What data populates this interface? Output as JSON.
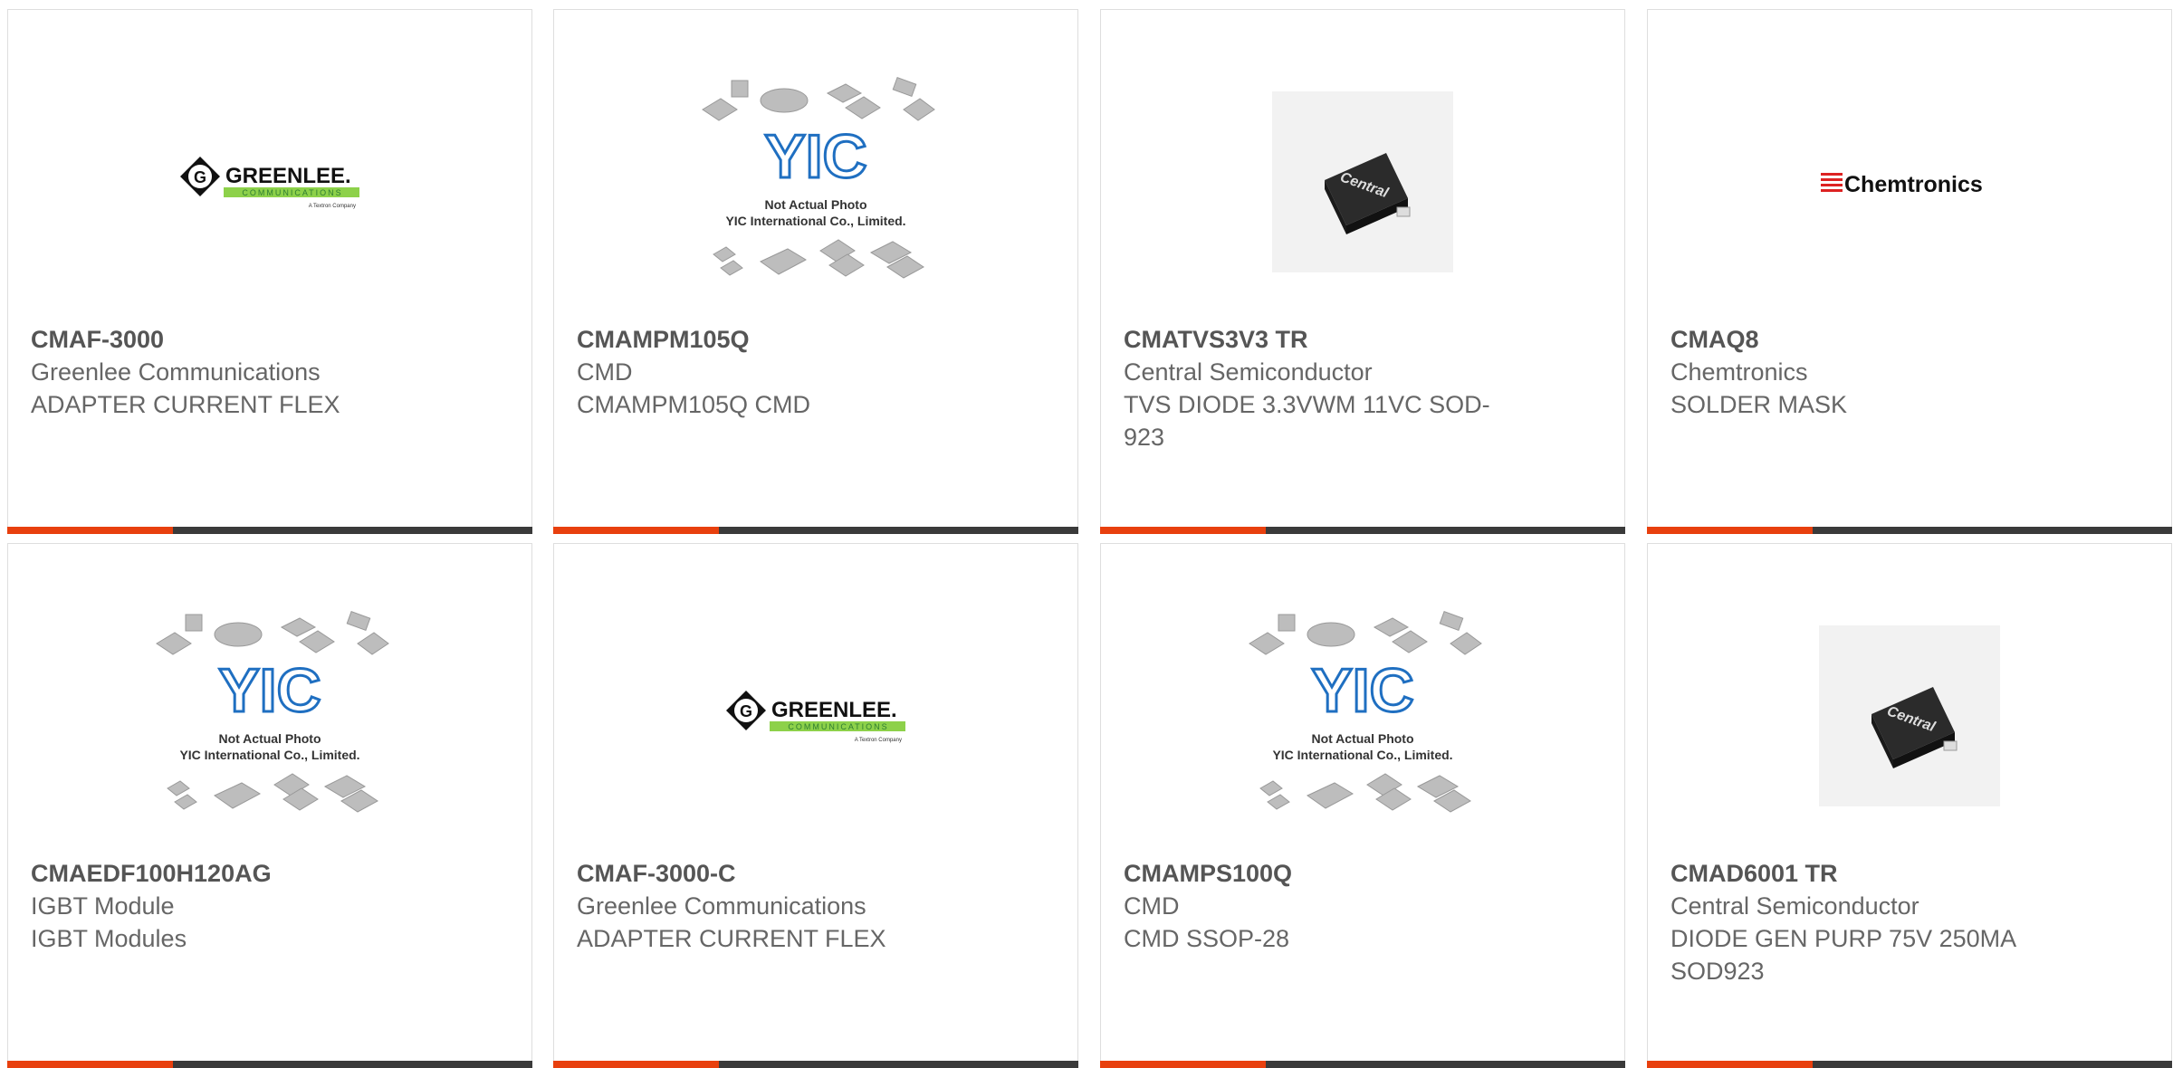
{
  "theme": {
    "accent": "#e8400e",
    "bar_dark": "#3a3a3a"
  },
  "products": [
    {
      "part": "CMAF-3000",
      "manufacturer": "Greenlee Communications",
      "description": "ADAPTER CURRENT FLEX",
      "image": "greenlee-logo",
      "logo": {
        "brand": "GREENLEE.",
        "sub": "COMMUNICATIONS",
        "tag": "A Textron Company"
      }
    },
    {
      "part": "CMAMPM105Q",
      "manufacturer": "CMD",
      "description": "CMAMPM105Q CMD",
      "image": "yic-placeholder",
      "placeholder": {
        "brand": "YIC",
        "line1": "Not Actual Photo",
        "line2": "YIC International Co., Limited."
      }
    },
    {
      "part": "CMATVS3V3 TR",
      "manufacturer": "Central Semiconductor",
      "description": "TVS DIODE 3.3VWM 11VC SOD-923",
      "image": "central-chip",
      "chip_label": "Central"
    },
    {
      "part": "CMAQ8",
      "manufacturer": "Chemtronics",
      "description": "SOLDER MASK",
      "image": "chemtronics-logo",
      "logo": {
        "brand": "Chemtronics"
      }
    },
    {
      "part": "CMAEDF100H120AG",
      "manufacturer": "IGBT Module",
      "description": "IGBT Modules",
      "image": "yic-placeholder",
      "placeholder": {
        "brand": "YIC",
        "line1": "Not Actual Photo",
        "line2": "YIC International Co., Limited."
      }
    },
    {
      "part": "CMAF-3000-C",
      "manufacturer": "Greenlee Communications",
      "description": "ADAPTER CURRENT FLEX",
      "image": "greenlee-logo",
      "logo": {
        "brand": "GREENLEE.",
        "sub": "COMMUNICATIONS",
        "tag": "A Textron Company"
      }
    },
    {
      "part": "CMAMPS100Q",
      "manufacturer": "CMD",
      "description": "CMD SSOP-28",
      "image": "yic-placeholder",
      "placeholder": {
        "brand": "YIC",
        "line1": "Not Actual Photo",
        "line2": "YIC International Co., Limited."
      }
    },
    {
      "part": "CMAD6001 TR",
      "manufacturer": "Central Semiconductor",
      "description": "DIODE GEN PURP 75V 250MA SOD923",
      "image": "central-chip",
      "chip_label": "Central"
    }
  ]
}
